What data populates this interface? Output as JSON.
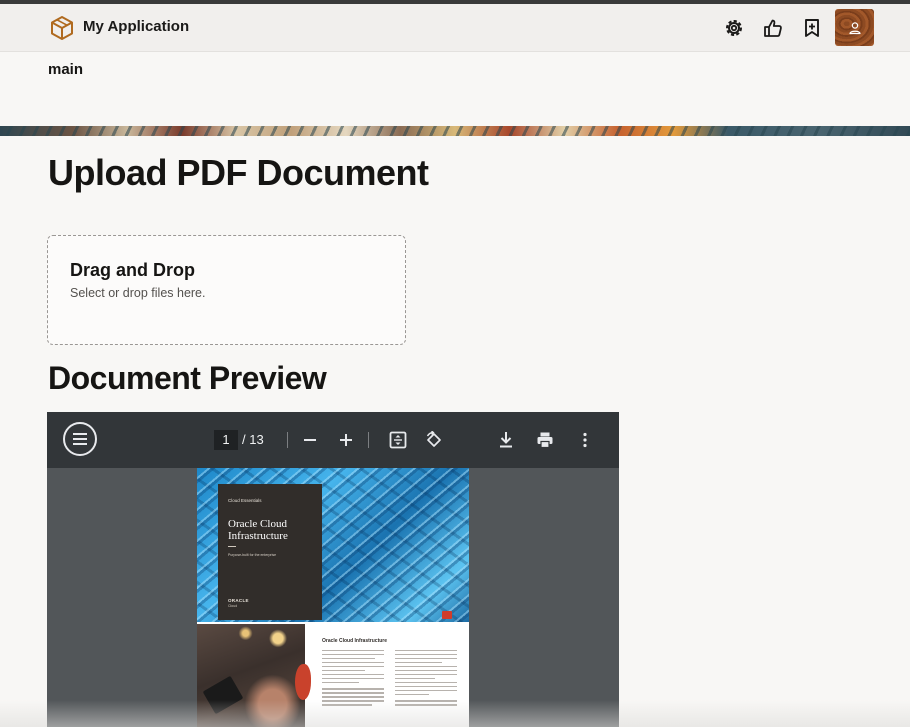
{
  "header": {
    "app_title": "My Application",
    "icons": [
      "cube-logo-icon",
      "settings-icon",
      "thumbs-up-icon",
      "bookmark-add-icon",
      "user-avatar-icon"
    ]
  },
  "region_label": "main",
  "upload": {
    "heading": "Upload PDF Document",
    "dropzone_title": "Drag and Drop",
    "dropzone_subtitle": "Select or drop files here."
  },
  "preview": {
    "heading": "Document Preview",
    "viewer": {
      "current_page": "1",
      "total_pages": "/ 13",
      "toolbar_icons": [
        "menu-icon",
        "zoom-out-icon",
        "zoom-in-icon",
        "fit-page-icon",
        "rotate-icon",
        "download-icon",
        "print-icon",
        "more-vert-icon"
      ]
    },
    "page": {
      "kicker": "Cloud Essentials",
      "title_line1": "Oracle Cloud",
      "title_line2": "Infrastructure",
      "subtitle": "Purpose-built for the enterprise",
      "brand": "ORACLE",
      "brand_sub": "Cloud",
      "section_title": "Oracle Cloud Infrastructure"
    }
  },
  "colors": {
    "page_bg": "#f8f7f5",
    "header_bg": "#f1efed",
    "viewer_bg": "#525659",
    "viewer_toolbar": "#323639",
    "text": "#161513"
  }
}
